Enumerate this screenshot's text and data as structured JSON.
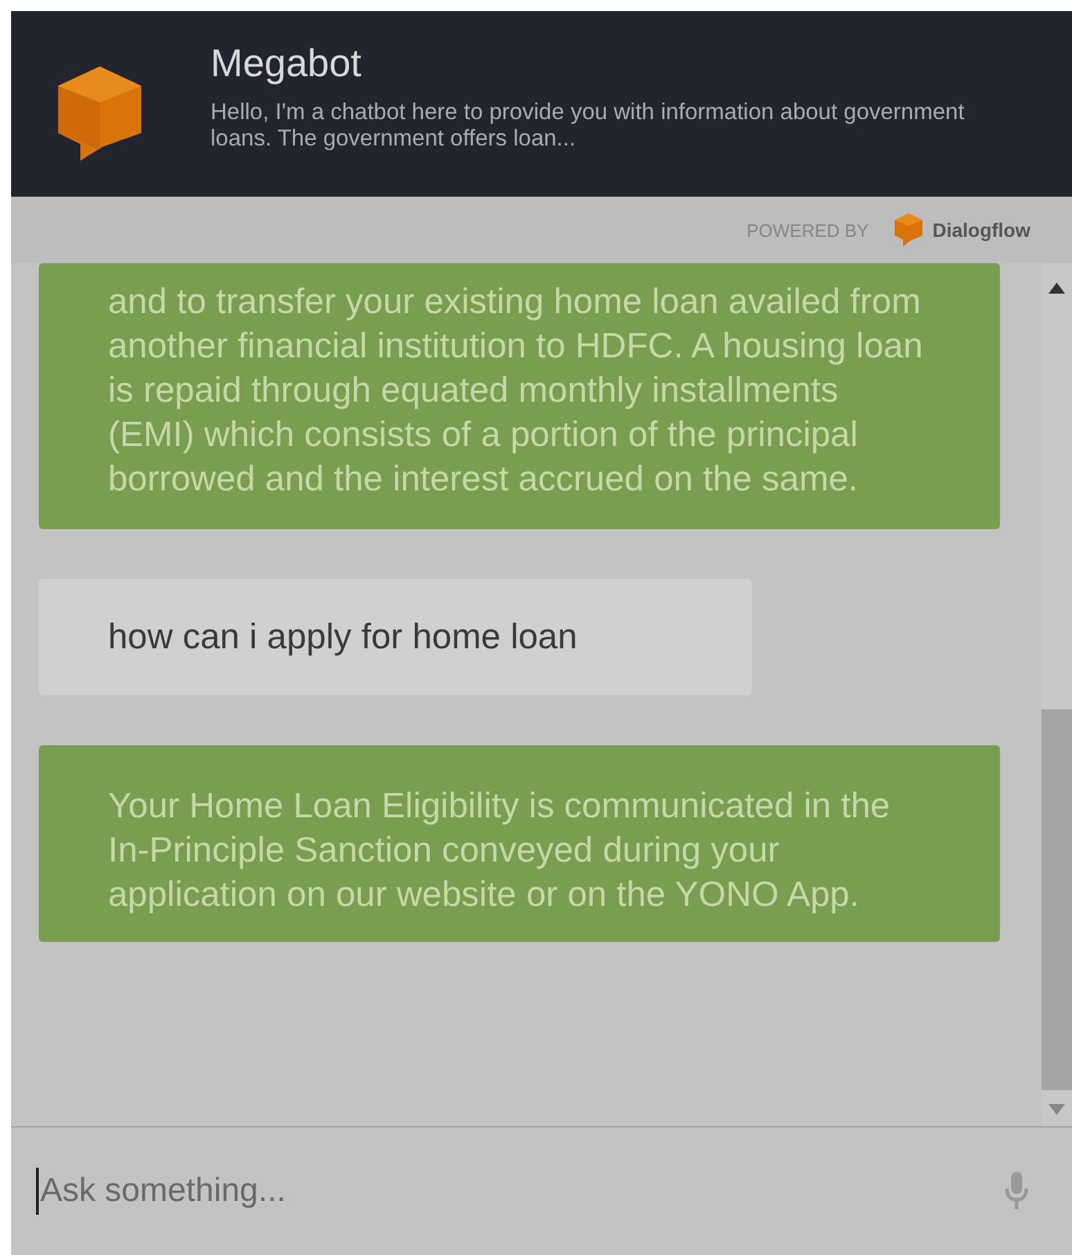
{
  "header": {
    "title": "Megabot",
    "description": "Hello, I'm a chatbot here to provide you with information about government loans. The government offers loan..."
  },
  "powered_by": {
    "label": "POWERED BY",
    "brand": "Dialogflow"
  },
  "messages": [
    {
      "kind": "bot",
      "text": "and to transfer your existing home loan availed from another financial institution to HDFC. A housing loan is repaid through equated monthly installments (EMI) which consists of a portion of the principal borrowed and the interest accrued on the same."
    },
    {
      "kind": "user",
      "text": "how can i apply for home loan"
    },
    {
      "kind": "bot",
      "text": "Your Home Loan Eligibility is communicated in the In-Principle Sanction conveyed during your application on our website or on the YONO App."
    }
  ],
  "input": {
    "placeholder": "Ask something..."
  }
}
